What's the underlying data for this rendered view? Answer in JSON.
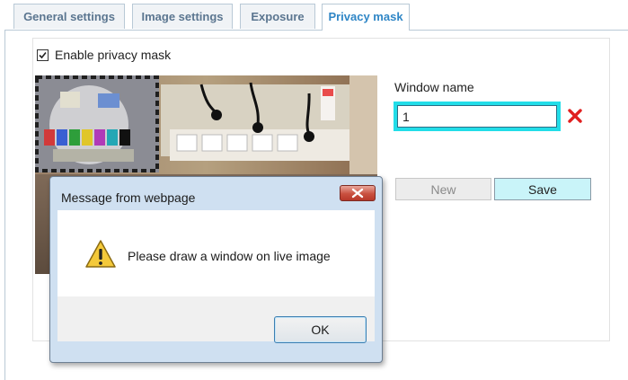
{
  "tabs": [
    {
      "label": "General settings",
      "active": false
    },
    {
      "label": "Image settings",
      "active": false
    },
    {
      "label": "Exposure",
      "active": false
    },
    {
      "label": "Privacy mask",
      "active": true
    }
  ],
  "privacy": {
    "enable_label": "Enable privacy mask",
    "enabled": true,
    "window_name_label": "Window name",
    "window_name_value": "1",
    "new_label": "New",
    "save_label": "Save",
    "delete_icon": "red-x-icon"
  },
  "dialog": {
    "title": "Message from webpage",
    "message": "Please draw a window on live image",
    "ok_label": "OK",
    "icon": "warning-icon"
  },
  "colors": {
    "active_tab": "#2f86c6",
    "input_highlight": "#22dde8",
    "save_button": "#c9f4f9",
    "delete_x": "#e02020"
  }
}
